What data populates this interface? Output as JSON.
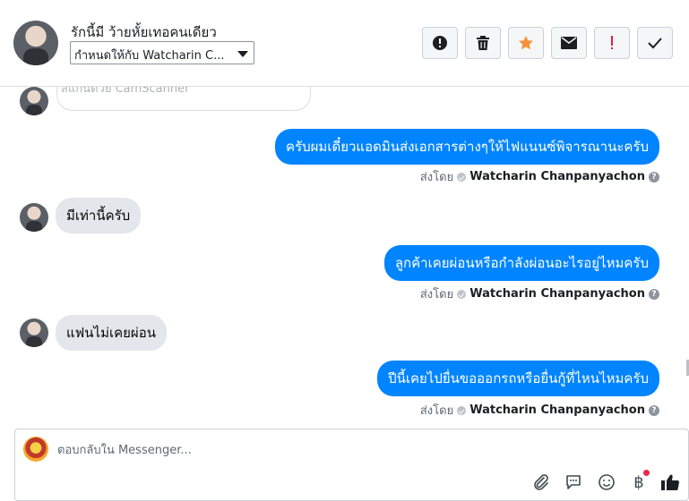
{
  "header": {
    "contact_name": "รักนี้มี ว้ายหั้ยเทอคนเดียว",
    "assign_value": "กำหนดให้กับ Watcharin C..."
  },
  "toolbar": {
    "buttons": [
      {
        "name": "alert-icon"
      },
      {
        "name": "trash-icon"
      },
      {
        "name": "star-icon",
        "color": "#f7923a"
      },
      {
        "name": "envelope-icon"
      },
      {
        "name": "exclamation-icon",
        "color": "#e41e3f"
      },
      {
        "name": "checkmark-icon"
      }
    ]
  },
  "thread": {
    "partial_text": "สแกนด้วย CamScanner",
    "messages": [
      {
        "direction": "out",
        "text": "ครับผมเดี๋ยวแอดมินส่งเอกสารต่างๆให้ไฟแนนซ์พิจารณานะครับ",
        "sent_prefix": "ส่งโดย",
        "sent_by": "Watcharin Chanpanyachon"
      },
      {
        "direction": "in",
        "text": "มีเท่านี้ครับ"
      },
      {
        "direction": "out",
        "text": "ลูกค้าเคยผ่อนหรือกำลังผ่อนอะไรอยู่ไหมครับ",
        "sent_prefix": "ส่งโดย",
        "sent_by": "Watcharin Chanpanyachon"
      },
      {
        "direction": "in",
        "text": "แฟนไม่เคยผ่อน"
      },
      {
        "direction": "out",
        "text": "ปีนี้เคยไปยื่นขอออกรถหรือยื่นกู้ที่ไหนไหมครับ",
        "sent_prefix": "ส่งโดย",
        "sent_by": "Watcharin Chanpanyachon"
      }
    ]
  },
  "composer": {
    "placeholder": "ตอบกลับใน Messenger...",
    "baht_symbol": "฿",
    "icons": [
      "paperclip-icon",
      "speech-bubble-icon",
      "smiley-icon",
      "baht-icon",
      "thumbs-up-icon"
    ]
  },
  "colors": {
    "outgoing_bubble": "#0084ff",
    "incoming_bubble": "#e4e6eb",
    "star": "#f7923a",
    "exclamation": "#e41e3f"
  }
}
